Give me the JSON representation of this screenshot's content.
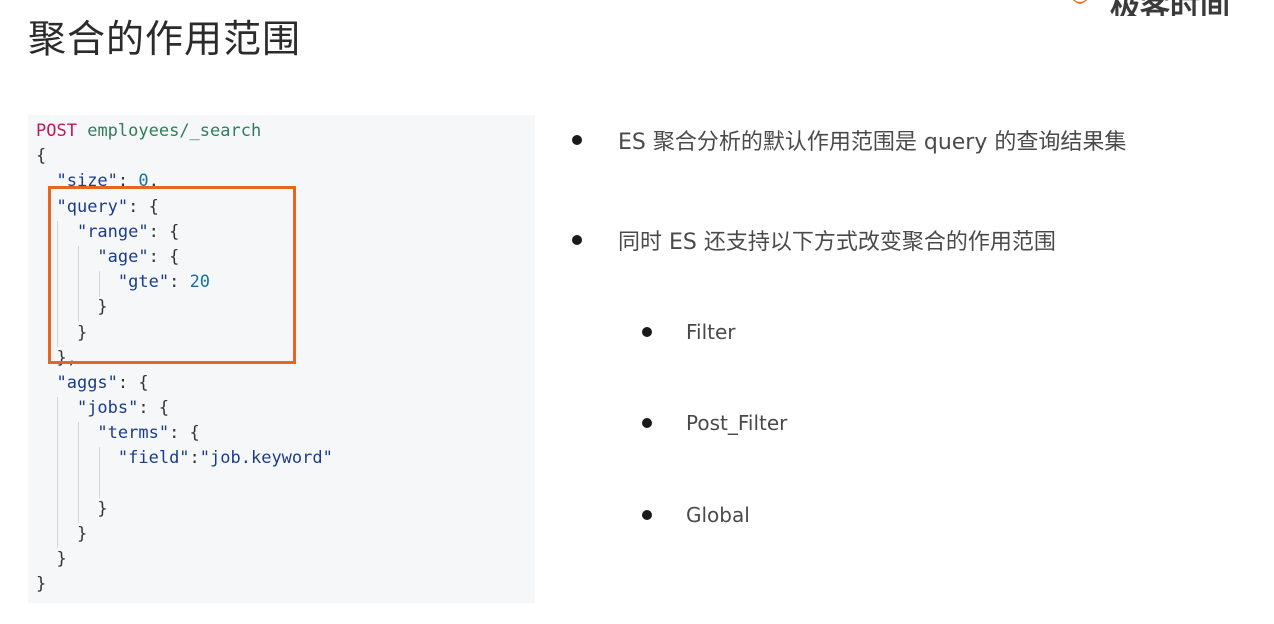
{
  "slide": {
    "title": "聚合的作用范围",
    "logo_text": "极客时间"
  },
  "code": {
    "lines": [
      [
        "POST",
        "employees/_search"
      ],
      [
        "{"
      ],
      [
        "\"size\"",
        ": ",
        "0",
        ","
      ],
      [
        "\"query\"",
        ": {"
      ],
      [
        "\"range\"",
        ": {"
      ],
      [
        "\"age\"",
        ": {"
      ],
      [
        "\"gte\"",
        ": ",
        "20"
      ],
      [
        "}"
      ],
      [
        "}"
      ],
      [
        "},"
      ],
      [
        "\"aggs\"",
        ": {"
      ],
      [
        "\"jobs\"",
        ": {"
      ],
      [
        "\"terms\"",
        ": {"
      ],
      [
        "\"field\"",
        ":",
        "\"job.keyword\""
      ],
      [
        ""
      ],
      [
        "}"
      ],
      [
        "}"
      ],
      [
        "}"
      ],
      [
        "}"
      ]
    ]
  },
  "bullets": [
    {
      "text": "ES 聚合分析的默认作用范围是 query 的查询结果集",
      "level": 1
    },
    {
      "text": "同时 ES 还支持以下方式改变聚合的作用范围",
      "level": 1
    },
    {
      "text": "Filter",
      "level": 2
    },
    {
      "text": "Post_Filter",
      "level": 2
    },
    {
      "text": "Global",
      "level": 2
    }
  ],
  "colors": {
    "highlight_border": "#e8651f",
    "logo_orange": "#f26b1d"
  }
}
